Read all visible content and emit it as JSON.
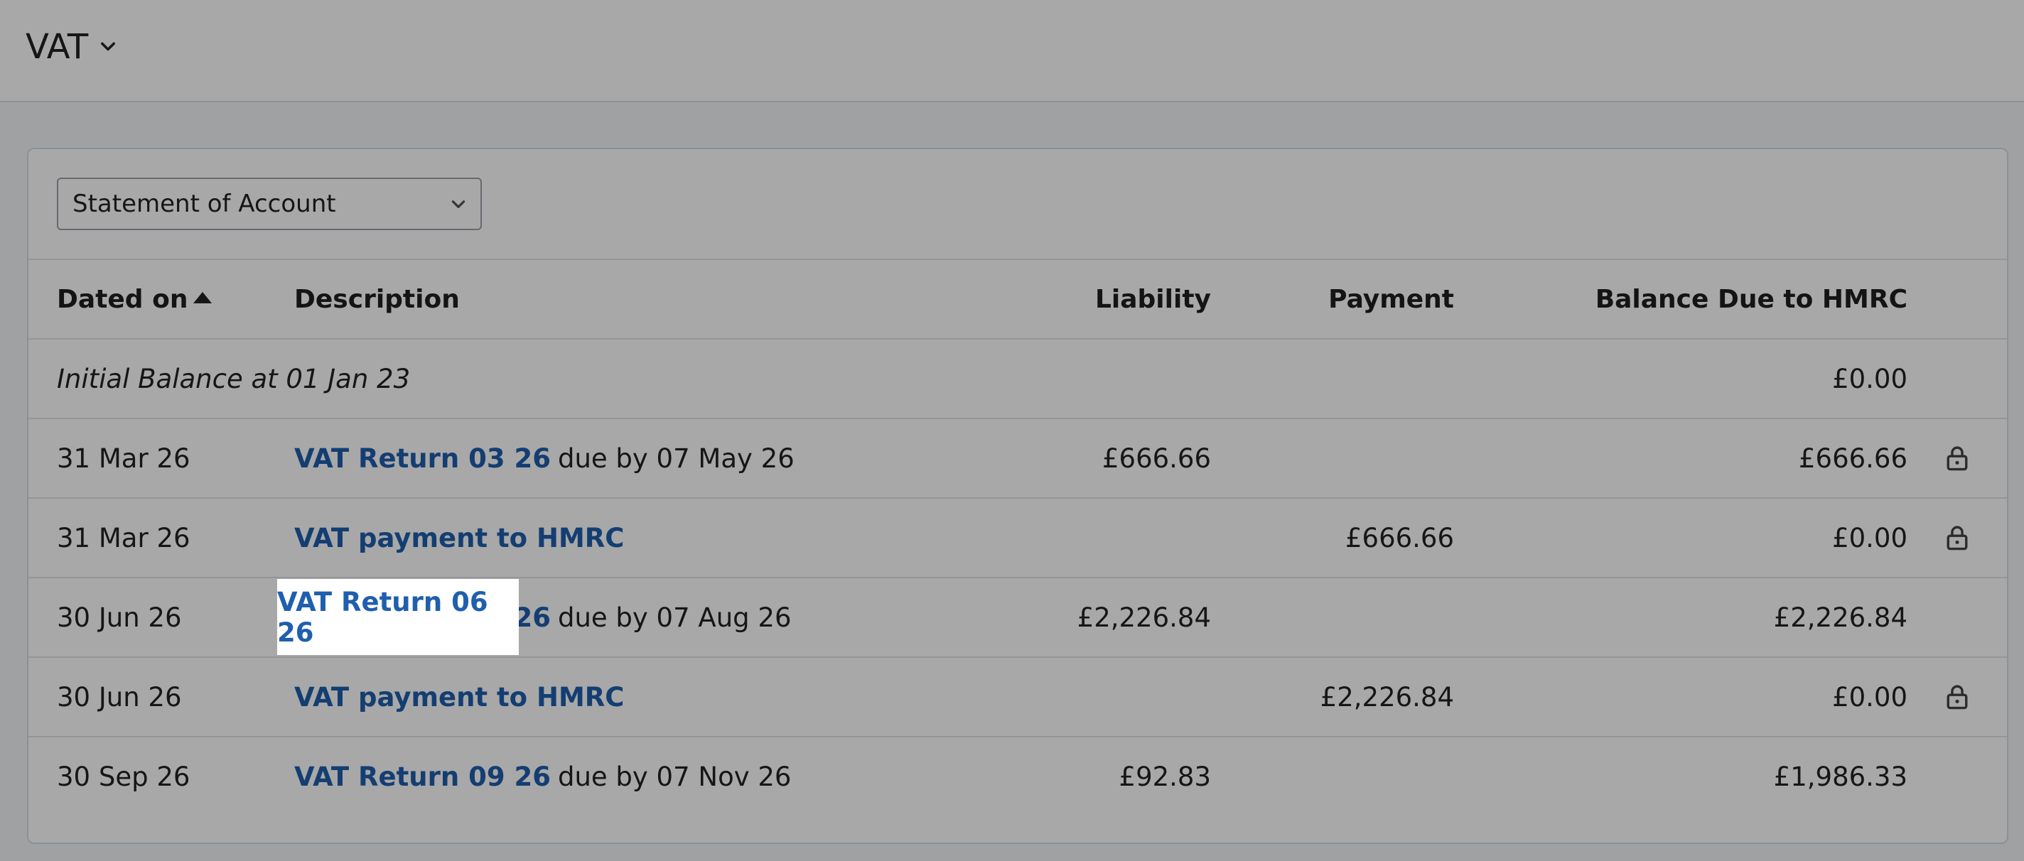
{
  "header": {
    "title": "VAT"
  },
  "filter": {
    "selected": "Statement of Account"
  },
  "table": {
    "columns": {
      "date": "Dated on",
      "description": "Description",
      "liability": "Liability",
      "payment": "Payment",
      "balance": "Balance Due to HMRC"
    },
    "initial": {
      "label": "Initial Balance at 01 Jan 23",
      "balance": "£0.00"
    },
    "rows": [
      {
        "date": "31 Mar 26",
        "link": "VAT Return 03 26",
        "suffix": "due by 07 May 26",
        "liability": "£666.66",
        "payment": "",
        "balance": "£666.66",
        "locked": true
      },
      {
        "date": "31 Mar 26",
        "link": "VAT payment to HMRC",
        "suffix": "",
        "liability": "",
        "payment": "£666.66",
        "balance": "£0.00",
        "locked": true
      },
      {
        "date": "30 Jun 26",
        "link": "VAT Return 06 26",
        "suffix": "due by 07 Aug 26",
        "liability": "£2,226.84",
        "payment": "",
        "balance": "£2,226.84",
        "locked": false
      },
      {
        "date": "30 Jun 26",
        "link": "VAT payment to HMRC",
        "suffix": "",
        "liability": "",
        "payment": "£2,226.84",
        "balance": "£0.00",
        "locked": true
      },
      {
        "date": "30 Sep 26",
        "link": "VAT Return 09 26",
        "suffix": "due by 07 Nov 26",
        "liability": "£92.83",
        "payment": "",
        "balance": "£1,986.33",
        "locked": false
      }
    ]
  },
  "icons": {
    "title_chevron": "chevron-down-icon",
    "select_chevron": "chevron-down-icon",
    "sort": "sort-ascending-icon",
    "lock": "lock-icon"
  },
  "colors": {
    "link": "#1f5fad",
    "overlay": "rgba(0,0,0,0.34)"
  }
}
